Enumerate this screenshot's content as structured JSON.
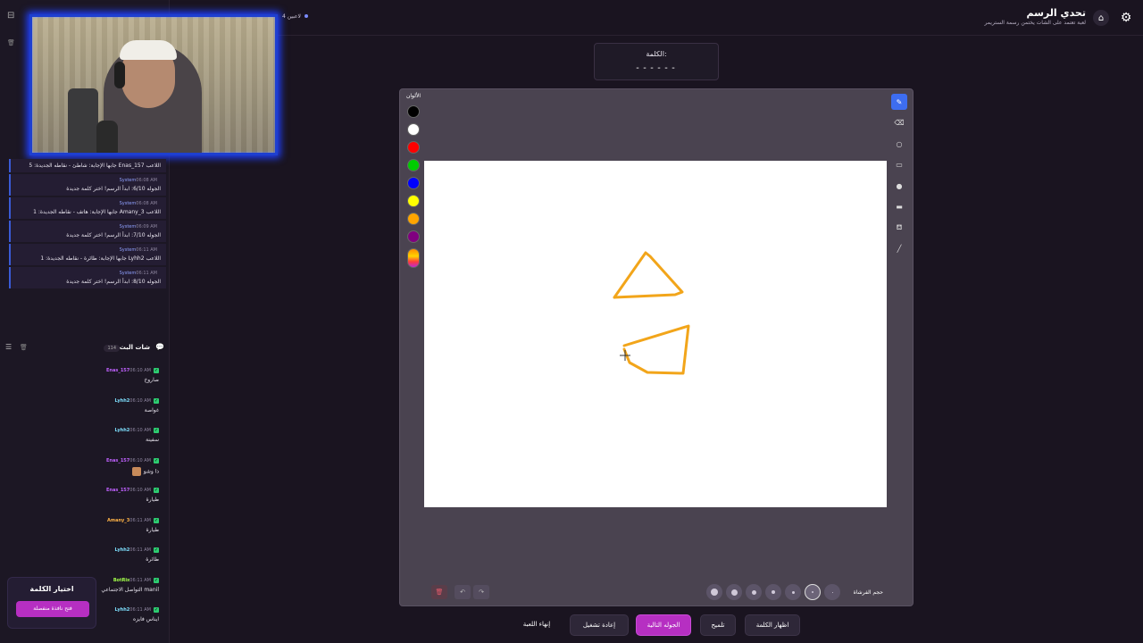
{
  "app": {
    "title": "تحدي الرسم",
    "subtitle": "لعبة تعتمد على الشات يختمن رسمة الستريمر",
    "players_count": "4 لاعبين"
  },
  "system_log": [
    {
      "time": "",
      "sender": "",
      "text": "اللاعب Enas_157 جابها الإجابة: شاطئ - نقاطه الجديدة: 5"
    },
    {
      "time": "06:08 AM",
      "sender": "System",
      "text": "الجوله 6/10: ابدأ الرسم! اختر كلمة جديدة"
    },
    {
      "time": "06:08 AM",
      "sender": "System",
      "text": "اللاعب Amany_3 جابها الإجابة: هاتف - نقاطه الجديدة: 1"
    },
    {
      "time": "06:09 AM",
      "sender": "System",
      "text": "الجوله 7/10: ابدأ الرسم! اختر كلمة جديدة"
    },
    {
      "time": "06:11 AM",
      "sender": "System",
      "text": "اللاعب Lyhh2 جابها الإجابة: طائرة - نقاطه الجديدة: 1"
    },
    {
      "time": "06:11 AM",
      "sender": "System",
      "text": "الجوله 8/10: ابدأ الرسم! اختر كلمة جديدة"
    }
  ],
  "chat": {
    "title": "شات البث",
    "count": "114",
    "messages": [
      {
        "time": "06:10 AM",
        "user": "Enas_157",
        "color": "#c061ff",
        "text": "صاروخ"
      },
      {
        "time": "06:10 AM",
        "user": "Lyhh2",
        "color": "#7ee0ff",
        "text": "غواصة"
      },
      {
        "time": "06:10 AM",
        "user": "Lyhh2",
        "color": "#7ee0ff",
        "text": "سفينة"
      },
      {
        "time": "06:10 AM",
        "user": "Enas_157",
        "color": "#c061ff",
        "text": "ذا وشو"
      },
      {
        "time": "06:10 AM",
        "user": "Enas_157",
        "color": "#c061ff",
        "text": "طيارة"
      },
      {
        "time": "06:11 AM",
        "user": "Amany_3",
        "color": "#ffb347",
        "text": "طيارة"
      },
      {
        "time": "06:11 AM",
        "user": "Lyhh2",
        "color": "#7ee0ff",
        "text": "طائرة"
      },
      {
        "time": "06:11 AM",
        "user": "BotRix",
        "color": "#a3ff4a",
        "text": "manil التواصل الاجتماعي"
      },
      {
        "time": "06:11 AM",
        "user": "Lyhh2",
        "color": "#7ee0ff",
        "text": "ايناس فايزه"
      }
    ]
  },
  "word_picker": {
    "title": "اختيار الكلمة",
    "button": "فتح نافذة منفصلة"
  },
  "word": {
    "label": "الكلمة:",
    "dashes": "------"
  },
  "canvas": {
    "colors_label": "الألوان",
    "colors": [
      "#000000",
      "#ffffff",
      "#ff0000",
      "#00cc00",
      "#0000ff",
      "#ffff00",
      "#ffa500",
      "#800080"
    ],
    "brush_label": "حجم الفرشاة",
    "stroke_color": "#f2a51a"
  },
  "tools": [
    "pencil-icon",
    "eraser-icon",
    "circle-icon",
    "rectangle-icon",
    "filled-circle-icon",
    "filled-rectangle-icon",
    "fill-bucket-icon",
    "line-icon"
  ],
  "actions": {
    "show_word": "اظهار الكلمة",
    "hint": "تلميح",
    "next_round": "الجوله التالية",
    "restart": "إعادة تشغيل",
    "end_game": "إنهاء اللعبة"
  }
}
